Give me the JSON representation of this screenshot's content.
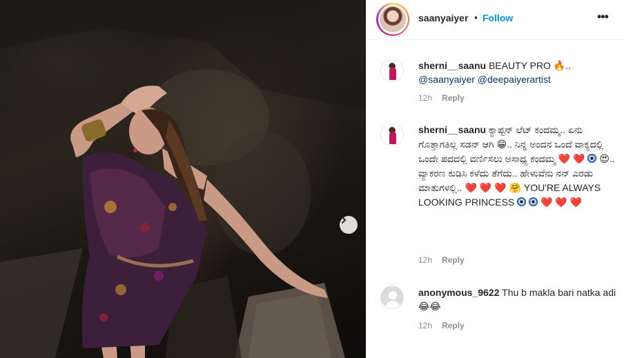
{
  "post": {
    "owner": "saanyaiyer",
    "separator": "•",
    "follow_label": "Follow",
    "more_label": "•••"
  },
  "icons": {
    "more": "more-options-icon",
    "next": "chevron-right-icon"
  },
  "colors": {
    "follow": "#0095f6",
    "mention": "#00376b",
    "meta": "#8e8e8e",
    "heart": "#ed4956"
  },
  "comments": [
    {
      "user": "sherni__saanu",
      "text": "BEAUTY PRO 🔥..",
      "mention1": "@saanyaiyer",
      "mention2": "@deepaiyerartist",
      "time": "12h",
      "reply": "Reply"
    },
    {
      "user": "sherni__saanu",
      "text1": "ಕ್ಯಾಪ್ಟನ್ ಲೆಟ್ ಕಂದಮ್ಮ.. ಏನು ಗೊತ್ತಾಗತಿಲ್ಲ ಸಡನ್ ಆಗಿ 😁.. ನಿನ್ನ ಅಂದನ ಒಂದೆ ವಾಕ್ಯದಲ್ಲಿ ಒಂದೇ ಪದದಲ್ಲಿ ವರ್ಣಿಸಲು ಅಸಾಧ್ಯ ಕಂದಮ್ಮ",
      "hearts1": "❤️ ❤️",
      "text2": "😍.. ವ್ಯಾಕರಣ ಕುಡಿಸಿ ಕಳೆದು ತೆಗೆದು.. ಹೇಳುವೆನು ನನ್ ಎರಡು ಮಾತುಗಳಲ್ಲಿ..",
      "hearts2": "❤️ ❤️ ❤️",
      "text3": "🤗 YOU'RE ALWAYS LOOKING PRINCESS",
      "hearts3": "❤️ ❤️ ❤️",
      "time": "12h",
      "reply": "Reply"
    },
    {
      "user": "anonymous_9622",
      "text": "Thu b makla bari natka adi 😂😂",
      "time": "12h",
      "reply": "Reply"
    }
  ]
}
